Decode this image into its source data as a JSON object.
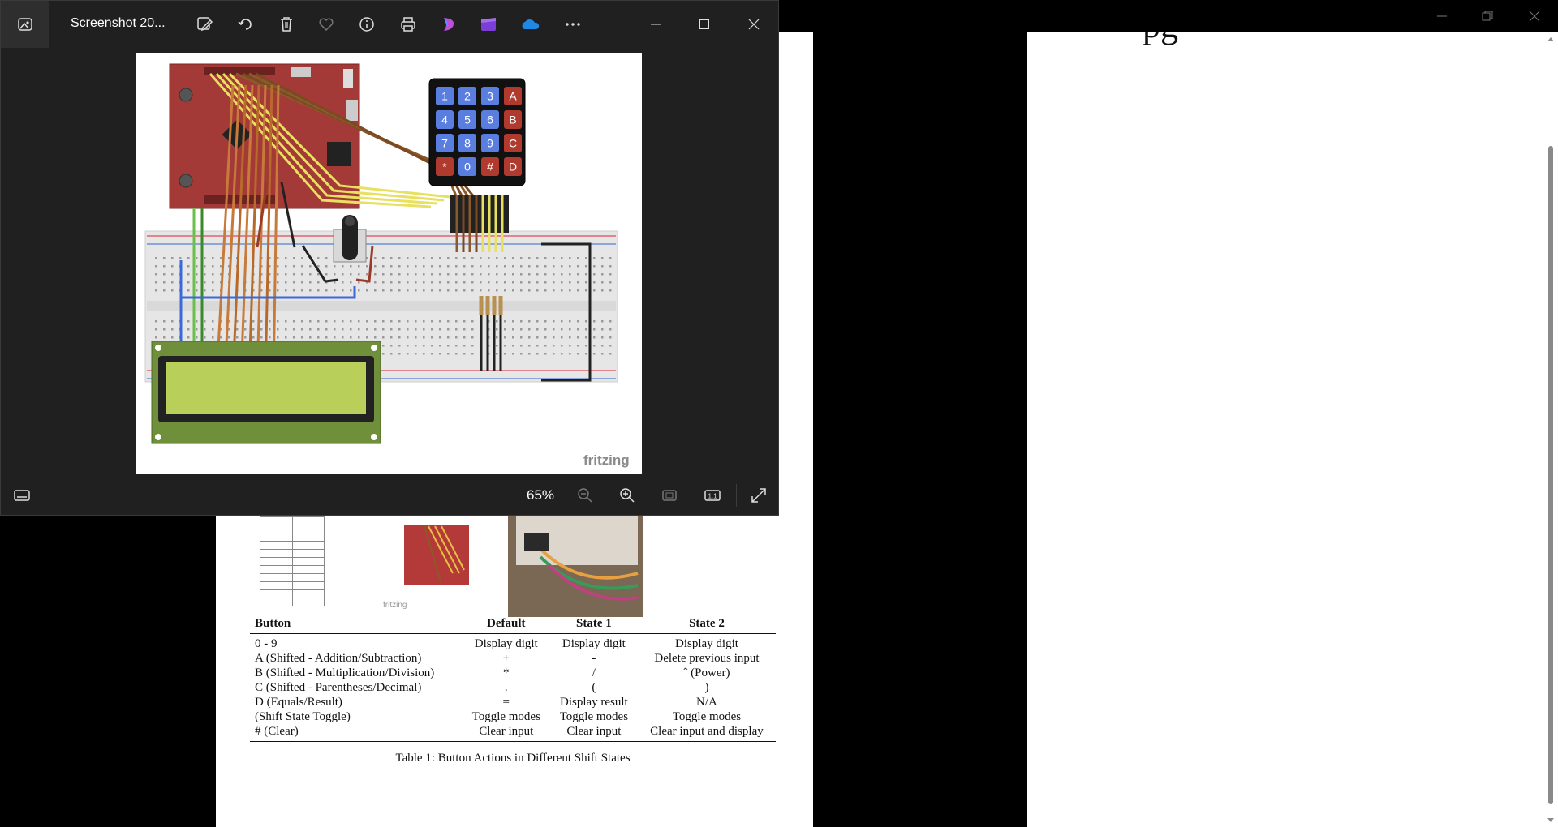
{
  "photos_app": {
    "title": "Screenshot 20...",
    "zoom_level": "65%",
    "toolbar_icons": [
      "edit-icon",
      "rotate-icon",
      "delete-icon",
      "favorite-icon",
      "info-icon",
      "print-icon",
      "clipchamp-icon",
      "video-editor-icon",
      "onedrive-icon",
      "more-icon"
    ],
    "window_controls": [
      "minimize",
      "maximize",
      "close"
    ]
  },
  "circuit_image": {
    "watermark": "fritzing",
    "keypad_keys": [
      "1",
      "2",
      "3",
      "A",
      "4",
      "5",
      "6",
      "B",
      "7",
      "8",
      "9",
      "C",
      "*",
      "0",
      "#",
      "D"
    ]
  },
  "document": {
    "thumbnail_watermark": "fritzing",
    "table": {
      "headers": [
        "Button",
        "Default",
        "State 1",
        "State 2"
      ],
      "rows": [
        [
          "0 - 9",
          "Display digit",
          "Display digit",
          "Display digit"
        ],
        [
          "A (Shifted - Addition/Subtraction)",
          "+",
          "-",
          "Delete previous input"
        ],
        [
          "B (Shifted - Multiplication/Division)",
          "*",
          "/",
          "ˆ (Power)"
        ],
        [
          "C (Shifted - Parentheses/Decimal)",
          ".",
          "(",
          ")"
        ],
        [
          "D (Equals/Result)",
          "=",
          "Display result",
          "N/A"
        ],
        [
          "(Shift State Toggle)",
          "Toggle modes",
          "Toggle modes",
          "Toggle modes"
        ],
        [
          "# (Clear)",
          "Clear input",
          "Clear input",
          "Clear input and display"
        ]
      ],
      "caption": "Table 1: Button Actions in Different Shift States"
    }
  },
  "colors": {
    "photos_bg": "#202020",
    "launchpad_red": "#a33a38",
    "keypad_blue": "#5a7de0",
    "keypad_red": "#b03a2e",
    "lcd_green": "#6f8f3a",
    "accent_blue": "#2c57a8"
  }
}
